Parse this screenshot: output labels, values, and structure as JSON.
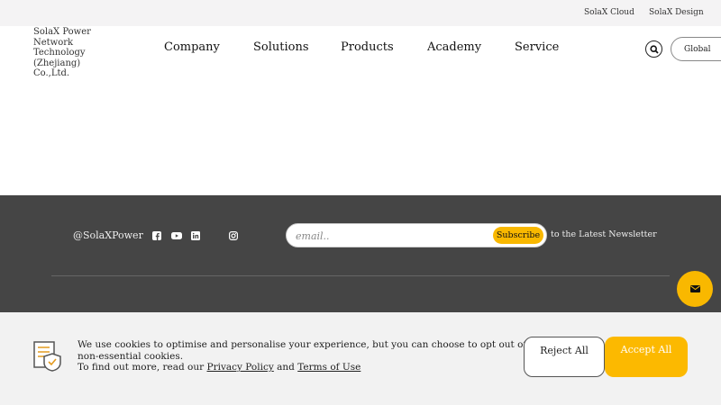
{
  "topbar": {
    "links": [
      "SolaX Cloud",
      "SolaX Design"
    ]
  },
  "header": {
    "logo_text": "SolaX Power Network Technology (Zhejiang) Co.,Ltd.",
    "nav": [
      "Company",
      "Solutions",
      "Products",
      "Academy",
      "Service"
    ],
    "region_label": "Global"
  },
  "footer": {
    "handle": "@SolaXPower",
    "social_icons": [
      "facebook-icon",
      "youtube-icon",
      "linkedin-icon",
      "instagram-icon"
    ],
    "email_placeholder": "email..",
    "subscribe_label": "Subscribe",
    "newsletter_text": "to the Latest Newsletter",
    "accent_color": "#f9b800",
    "background_color": "#454545"
  },
  "cookie_banner": {
    "line1": "We use cookies to optimise and personalise your experience, but you can choose to opt out of non-essential cookies.",
    "line2_prefix": "To find out more, read our",
    "privacy_link": "Privacy Policy",
    "and_text": "and",
    "terms_link": "Terms of Use",
    "reject_label": "Reject All",
    "accept_label": "Accept All"
  }
}
